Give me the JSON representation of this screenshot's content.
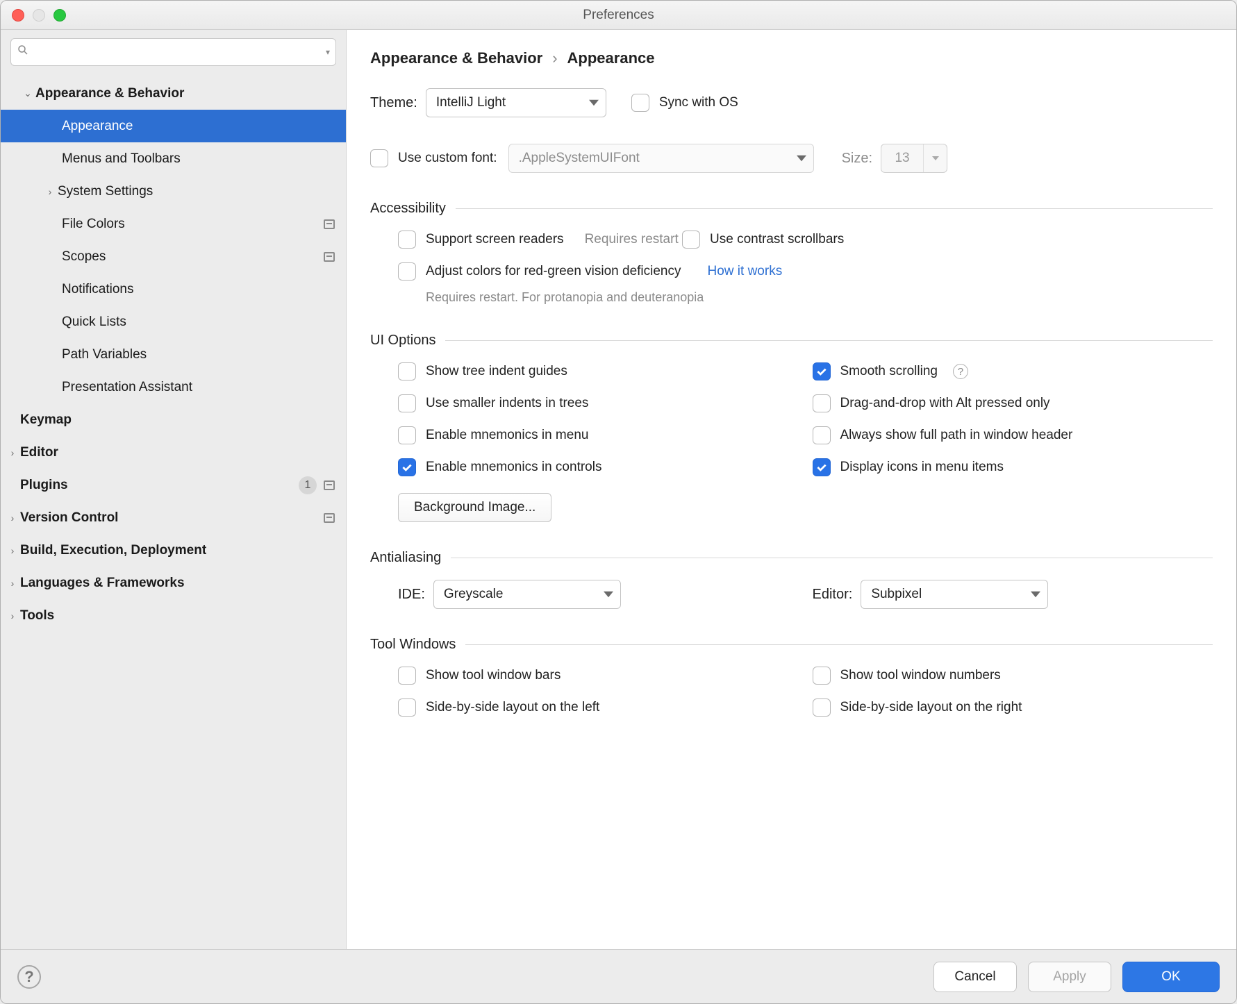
{
  "window": {
    "title": "Preferences"
  },
  "sidebar": {
    "search_placeholder": "",
    "items": [
      {
        "label": "Appearance & Behavior",
        "bold": true,
        "depth": 0,
        "arrow": "down"
      },
      {
        "label": "Appearance",
        "depth": 2,
        "selected": true
      },
      {
        "label": "Menus and Toolbars",
        "depth": 2
      },
      {
        "label": "System Settings",
        "depth": 1,
        "arrow": "right"
      },
      {
        "label": "File Colors",
        "depth": 2,
        "project": true
      },
      {
        "label": "Scopes",
        "depth": 2,
        "project": true
      },
      {
        "label": "Notifications",
        "depth": 2
      },
      {
        "label": "Quick Lists",
        "depth": 2
      },
      {
        "label": "Path Variables",
        "depth": 2
      },
      {
        "label": "Presentation Assistant",
        "depth": 2
      },
      {
        "label": "Keymap",
        "bold": true,
        "depth": 0
      },
      {
        "label": "Editor",
        "bold": true,
        "depth": 0,
        "arrow": "right",
        "leading": true
      },
      {
        "label": "Plugins",
        "bold": true,
        "depth": 0,
        "badge": "1",
        "project": true
      },
      {
        "label": "Version Control",
        "bold": true,
        "depth": 0,
        "arrow": "right",
        "leading": true,
        "project": true
      },
      {
        "label": "Build, Execution, Deployment",
        "bold": true,
        "depth": 0,
        "arrow": "right",
        "leading": true
      },
      {
        "label": "Languages & Frameworks",
        "bold": true,
        "depth": 0,
        "arrow": "right",
        "leading": true
      },
      {
        "label": "Tools",
        "bold": true,
        "depth": 0,
        "arrow": "right",
        "leading": true
      }
    ]
  },
  "breadcrumb": {
    "parent": "Appearance & Behavior",
    "page": "Appearance"
  },
  "theme": {
    "label": "Theme:",
    "value": "IntelliJ Light",
    "sync_label": "Sync with OS",
    "sync_checked": false
  },
  "font": {
    "use_custom_label": "Use custom font:",
    "use_custom_checked": false,
    "font_value": ".AppleSystemUIFont",
    "size_label": "Size:",
    "size_value": "13"
  },
  "sections": {
    "accessibility": {
      "title": "Accessibility",
      "screen_readers": {
        "label": "Support screen readers",
        "hint": "Requires restart",
        "checked": false
      },
      "contrast_scrollbars": {
        "label": "Use contrast scrollbars",
        "checked": false
      },
      "color_adjust": {
        "label": "Adjust colors for red-green vision deficiency",
        "link": "How it works",
        "hint": "Requires restart. For protanopia and deuteranopia",
        "checked": false
      }
    },
    "ui": {
      "title": "UI Options",
      "tree_guides": {
        "label": "Show tree indent guides",
        "checked": false
      },
      "smaller_indents": {
        "label": "Use smaller indents in trees",
        "checked": false
      },
      "mnemonics_menu": {
        "label": "Enable mnemonics in menu",
        "checked": false
      },
      "mnemonics_controls": {
        "label": "Enable mnemonics in controls",
        "checked": true
      },
      "smooth_scroll": {
        "label": "Smooth scrolling",
        "checked": true
      },
      "dnd_alt": {
        "label": "Drag-and-drop with Alt pressed only",
        "checked": false
      },
      "full_path": {
        "label": "Always show full path in window header",
        "checked": false
      },
      "menu_icons": {
        "label": "Display icons in menu items",
        "checked": true
      },
      "bg_image_btn": "Background Image..."
    },
    "antialiasing": {
      "title": "Antialiasing",
      "ide_label": "IDE:",
      "ide_value": "Greyscale",
      "editor_label": "Editor:",
      "editor_value": "Subpixel"
    },
    "tool_windows": {
      "title": "Tool Windows",
      "show_bars": {
        "label": "Show tool window bars",
        "checked": false
      },
      "show_numbers": {
        "label": "Show tool window numbers",
        "checked": false
      },
      "side_left": {
        "label": "Side-by-side layout on the left",
        "checked": false
      },
      "side_right": {
        "label": "Side-by-side layout on the right",
        "checked": false
      }
    }
  },
  "footer": {
    "cancel": "Cancel",
    "apply": "Apply",
    "ok": "OK"
  }
}
